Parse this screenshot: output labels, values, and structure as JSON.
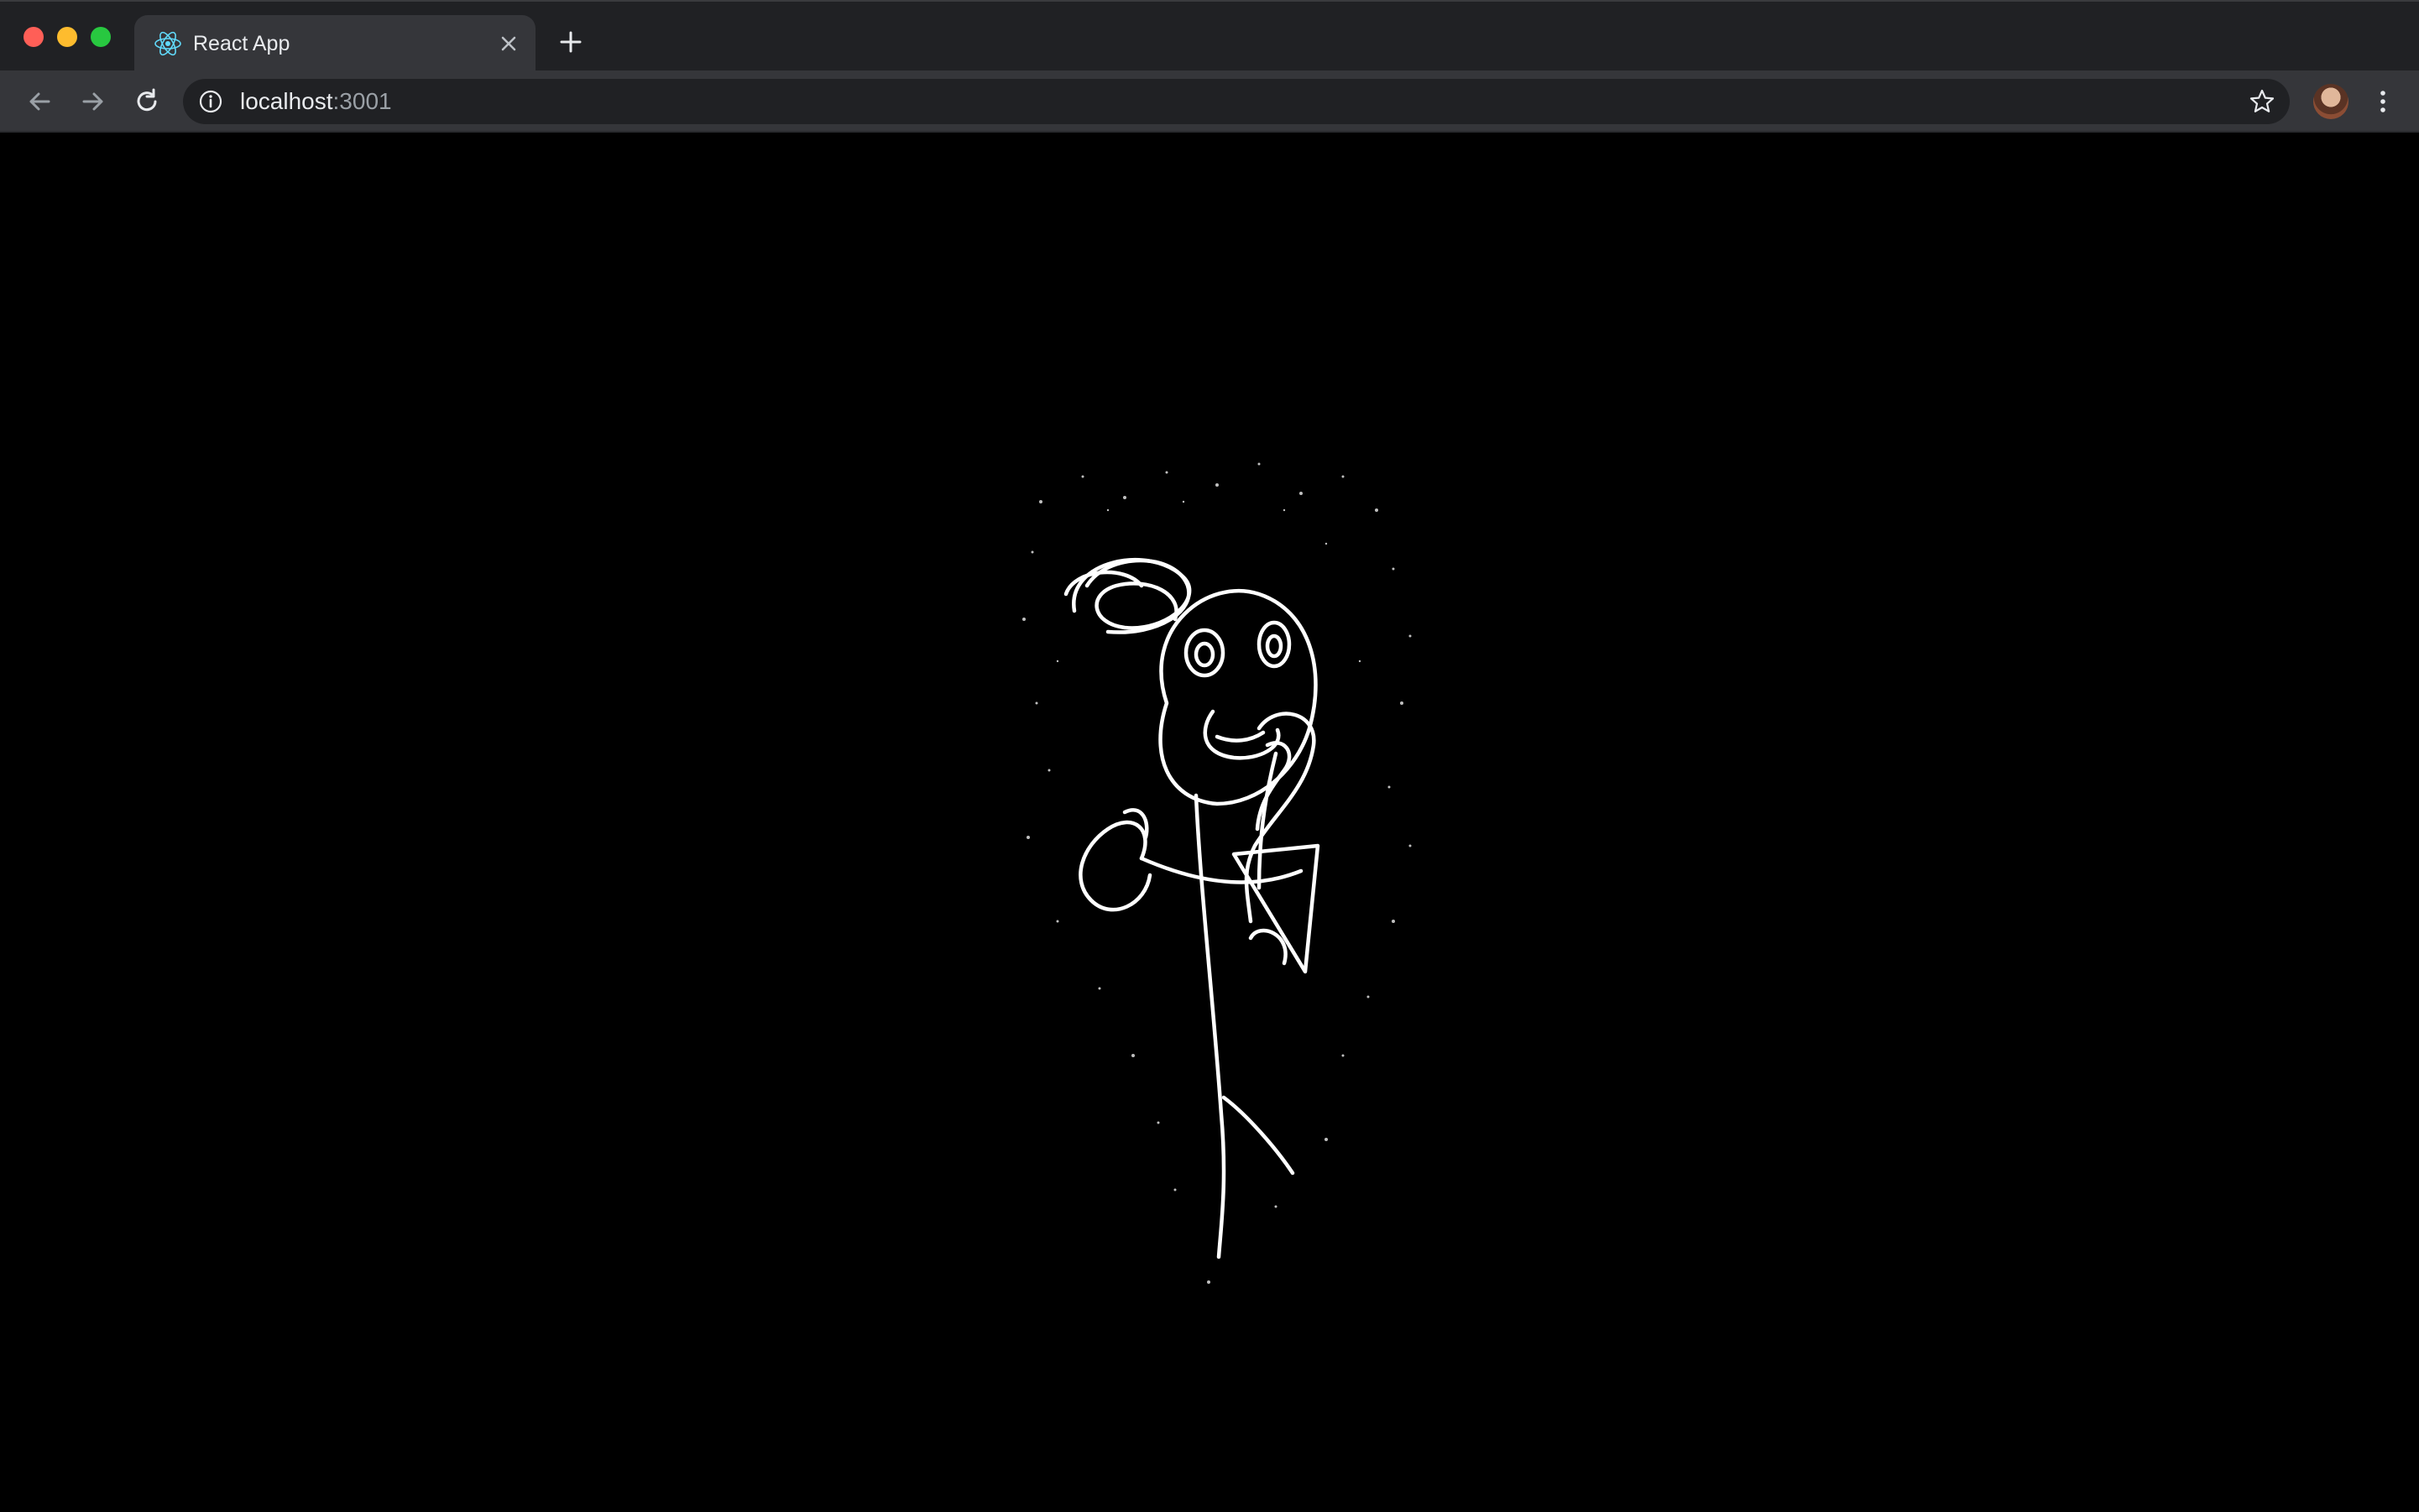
{
  "browser": {
    "tab": {
      "title": "React App",
      "favicon": "react-logo-icon"
    },
    "omnibox": {
      "host": "localhost",
      "port": ":3001",
      "info_icon": "info-icon",
      "bookmark_icon": "star-icon"
    },
    "buttons": [
      "back-icon",
      "forward-icon",
      "reload-icon",
      "new-tab-icon",
      "menu-icon"
    ]
  },
  "canvas": {
    "background": "#000000",
    "stroke_color": "#ffffff",
    "content": "hand-drawn stick figure sketch"
  }
}
